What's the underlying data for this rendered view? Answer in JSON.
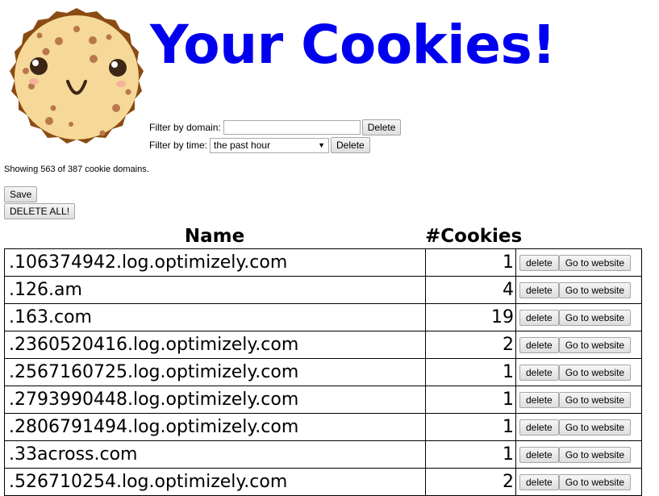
{
  "header": {
    "title": "Your Cookies!"
  },
  "filters": {
    "domain_label": "Filter by domain:",
    "domain_value": "",
    "domain_delete": "Delete",
    "time_label": "Filter by time:",
    "time_selected": "the past hour",
    "time_delete": "Delete"
  },
  "status": "Showing 563 of 387 cookie domains.",
  "actions": {
    "save": "Save",
    "delete_all": "DELETE ALL!"
  },
  "table": {
    "columns": [
      "Name",
      "#Cookies"
    ],
    "row_delete_label": "delete",
    "row_go_label": "Go to website",
    "rows": [
      {
        "name": ".106374942.log.optimizely.com",
        "count": "1"
      },
      {
        "name": ".126.am",
        "count": "4"
      },
      {
        "name": ".163.com",
        "count": "19"
      },
      {
        "name": ".2360520416.log.optimizely.com",
        "count": "2"
      },
      {
        "name": ".2567160725.log.optimizely.com",
        "count": "1"
      },
      {
        "name": ".2793990448.log.optimizely.com",
        "count": "1"
      },
      {
        "name": ".2806791494.log.optimizely.com",
        "count": "1"
      },
      {
        "name": ".33across.com",
        "count": "1"
      },
      {
        "name": ".526710254.log.optimizely.com",
        "count": "2"
      }
    ]
  },
  "colors": {
    "title": "#0000ee",
    "cookie_fill": "#f6d998",
    "cookie_edge": "#8a4b12",
    "chip": "#b8784a"
  }
}
